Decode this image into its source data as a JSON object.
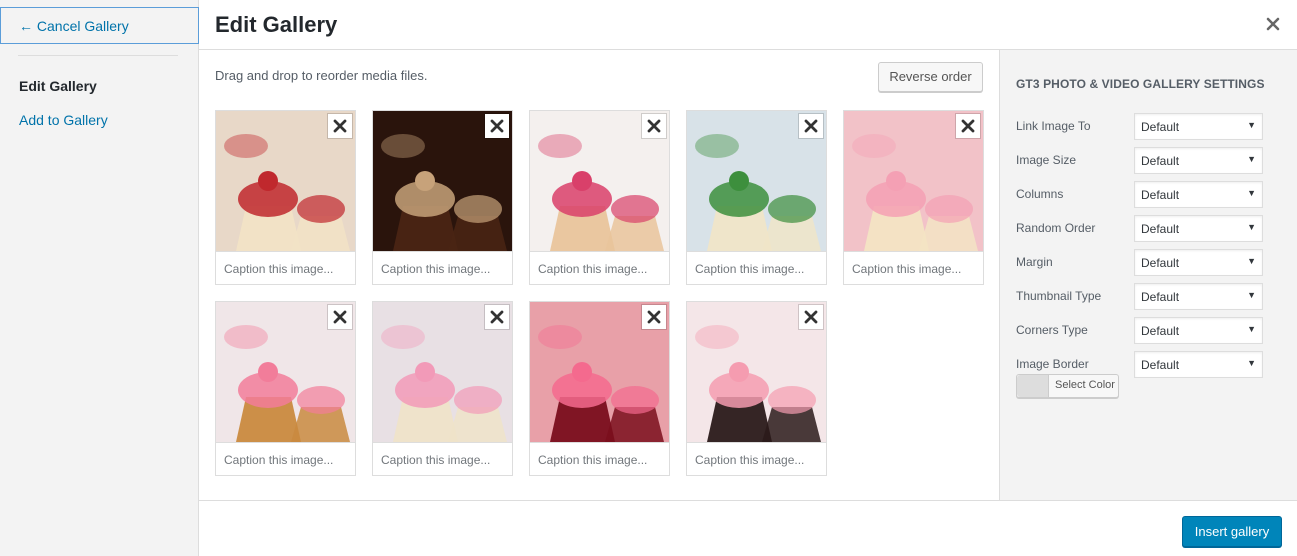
{
  "sidebar": {
    "cancel_label": "← Cancel Gallery",
    "items": [
      {
        "label": "Edit Gallery"
      },
      {
        "label": "Add to Gallery"
      }
    ]
  },
  "header": {
    "title": "Edit Gallery",
    "close_icon": "close-icon"
  },
  "main": {
    "hint": "Drag and drop to reorder media files.",
    "reverse_label": "Reverse order",
    "caption_placeholder": "Caption this image...",
    "images": [
      {
        "name": "cupcakes-strawberry",
        "colors": [
          "#e8d8c8",
          "#c0282d",
          "#f2e3c6"
        ]
      },
      {
        "name": "cupcakes-chocolate",
        "colors": [
          "#2a140c",
          "#c7a27a",
          "#4a2414"
        ]
      },
      {
        "name": "cupcakes-pink-cream",
        "colors": [
          "#f4f0ee",
          "#d9406a",
          "#e9c49b"
        ]
      },
      {
        "name": "cupcakes-green",
        "colors": [
          "#d8e2e8",
          "#3d8f3d",
          "#f0e5c8"
        ]
      },
      {
        "name": "cupcake-pink-flower",
        "colors": [
          "#f2c2c8",
          "#f4a0b4",
          "#f3e4c4"
        ]
      },
      {
        "name": "cupcakes-hearts",
        "colors": [
          "#f0e6e8",
          "#f27d9a",
          "#c98a3f"
        ]
      },
      {
        "name": "cupcake-rose",
        "colors": [
          "#e8e0e4",
          "#f29ab8",
          "#efe3c9"
        ]
      },
      {
        "name": "cupcake-cherry",
        "colors": [
          "#e8a0a8",
          "#f46a8e",
          "#7a0e1c"
        ]
      },
      {
        "name": "cupcakes-pink-dots",
        "colors": [
          "#f4e6e8",
          "#f59cb0",
          "#2a1a1a"
        ]
      }
    ]
  },
  "settings": {
    "heading": "GT3 Photo & Video Gallery Settings",
    "fields": [
      {
        "label": "Link Image To",
        "value": "Default"
      },
      {
        "label": "Image Size",
        "value": "Default"
      },
      {
        "label": "Columns",
        "value": "Default"
      },
      {
        "label": "Random Order",
        "value": "Default"
      },
      {
        "label": "Margin",
        "value": "Default"
      },
      {
        "label": "Thumbnail Type",
        "value": "Default"
      },
      {
        "label": "Corners Type",
        "value": "Default"
      },
      {
        "label": "Image Border",
        "value": "Default"
      }
    ],
    "color_button": "Select Color"
  },
  "footer": {
    "insert_label": "Insert gallery"
  }
}
